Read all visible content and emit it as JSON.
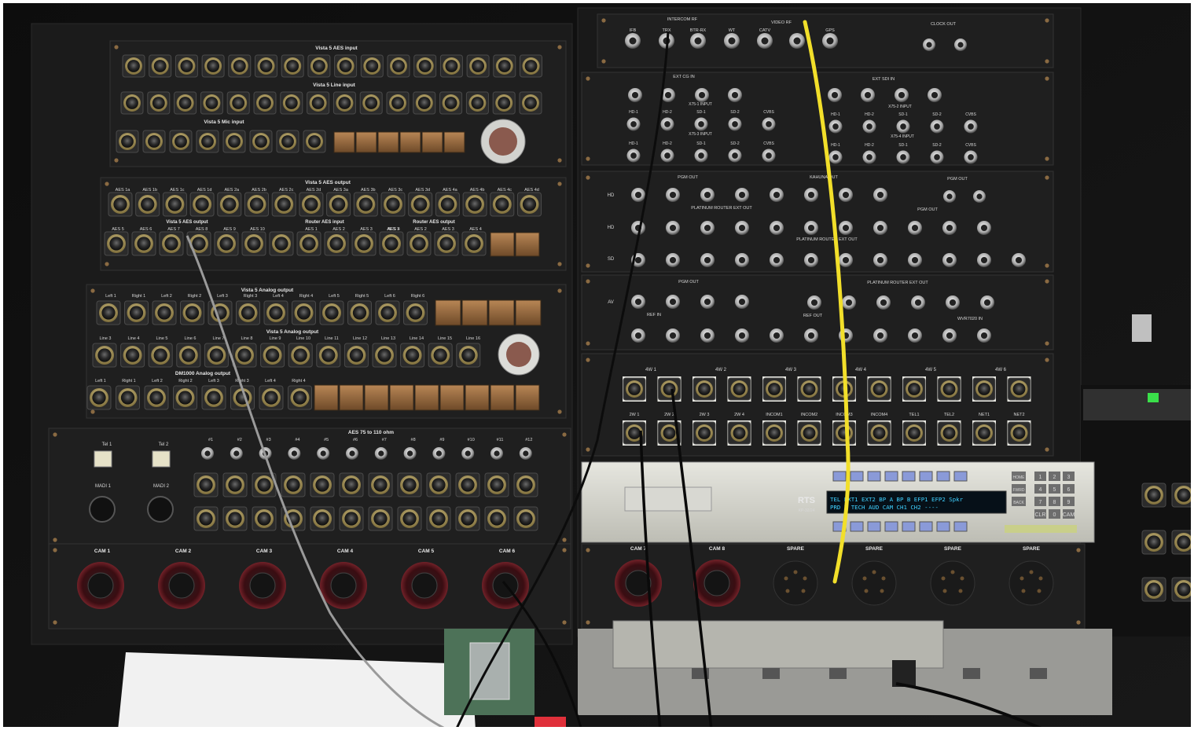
{
  "rack": {
    "left_panel": {
      "aes_input_title": "Vista 5 AES input",
      "line_input_title": "Vista 5 Line input",
      "mic_input_title": "Vista 5 Mic input",
      "aes_output_title": "Vista 5 AES output",
      "aes_output_labels": [
        "AES 1a",
        "AES 1b",
        "AES 1c",
        "AES 1d",
        "AES 2a",
        "AES 2b",
        "AES 2c",
        "AES 2d",
        "AES 3a",
        "AES 3b",
        "AES 3c",
        "AES 3d",
        "AES 4a",
        "AES 4b",
        "AES 4c",
        "AES 4d"
      ],
      "aes_output2_labels": [
        "AES 5",
        "AES 6",
        "AES 7",
        "AES 8",
        "AES 9",
        "AES 10"
      ],
      "aes_output2_title": "Vista 5 AES output",
      "router_aes_input_title": "Router AES input",
      "router_aes_input_labels": [
        "AES 1",
        "AES 2",
        "AES 3",
        "AES 4"
      ],
      "router_aes_output_title": "Router AES output",
      "router_aes_output_labels": [
        "AES 1",
        "AES 2",
        "AES 3",
        "AES 4"
      ],
      "analog_output_title": "Vista 5 Analog output",
      "analog_output_labels": [
        "Left 1",
        "Right 1",
        "Left 2",
        "Right 2",
        "Left 3",
        "Right 3",
        "Left 4",
        "Right 4",
        "Left 5",
        "Right 5",
        "Left 6",
        "Right 6"
      ],
      "analog_output2_title": "Vista 5 Analog output",
      "analog_output2_labels": [
        "Line 3",
        "Line 4",
        "Line 5",
        "Line 6",
        "Line 7",
        "Line 8",
        "Line 9",
        "Line 10",
        "Line 11",
        "Line 12",
        "Line 13",
        "Line 14",
        "Line 15",
        "Line 16"
      ],
      "dm1000_title": "DM1000 Analog output",
      "dm1000_labels": [
        "Left 1",
        "Right 1",
        "Left 2",
        "Right 2",
        "Left 3",
        "Right 3",
        "Left 4",
        "Right 4"
      ],
      "aes75_title": "AES 75 to 110 ohm",
      "aes75_labels": [
        "#1",
        "#2",
        "#3",
        "#4",
        "#5",
        "#6",
        "#7",
        "#8",
        "#9",
        "#10",
        "#11",
        "#12"
      ],
      "tel_labels": [
        "Tel 1",
        "Tel 2"
      ],
      "madi_labels": [
        "MADI 1",
        "MADI 2"
      ],
      "cam_labels": [
        "CAM 1",
        "CAM 2",
        "CAM 3",
        "CAM 4",
        "CAM 5",
        "CAM 6"
      ]
    },
    "right_panel": {
      "top_labels": [
        "IFB",
        "TRX",
        "BTR-RX",
        "WT",
        "CATV",
        "GPS"
      ],
      "intercom_rf_title": "INTERCOM RF",
      "video_rf_title": "VIDEO RF",
      "clock_out_title": "CLOCK OUT",
      "ext_cg_in_title": "EXT CG IN",
      "ext_sdi_in_title": "EXT SDI IN",
      "x75_1_input": "X75-1 INPUT",
      "x75_2_input": "X75-2 INPUT",
      "x75_3_input": "X75-3 INPUT",
      "x75_4_input": "X75-4 INPUT",
      "hd_labels": [
        "HD-1",
        "HD-2",
        "SD-1",
        "SD-2",
        "CVBS"
      ],
      "pgm_out_title": "PGM OUT",
      "kahuna_out_title": "KAHUNA OUT",
      "platinum_router_ext_out": "PLATINUM ROUTER EXT OUT",
      "row_labels": [
        "HD",
        "HD",
        "SD",
        "AV"
      ],
      "ref_in_title": "REF IN",
      "ref_out_title": "REF OUT",
      "wvr_in_title": "WVR7020 IN",
      "fourw_labels": [
        "4W 1",
        "4W 2",
        "4W 3",
        "4W 4",
        "4W 5",
        "4W 6"
      ],
      "twow_labels": [
        "2W 1",
        "2W 2",
        "2W 3",
        "2W 4",
        "INCOM1",
        "INCOM2",
        "INCOM3",
        "INCOM4",
        "TEL1",
        "TEL2",
        "NET1",
        "NET2"
      ],
      "cam_labels": [
        "CAM 7",
        "CAM 8",
        "SPARE",
        "SPARE",
        "SPARE",
        "SPARE"
      ]
    },
    "intercom_unit": {
      "brand": "RTS",
      "model": "KP-32/24",
      "display_line1": "TEL  EXT1 EXT2 BP A BP B EFP1 EFP2 Spkr",
      "display_line2": "PRD  2    TECH AUD CAM  CH1  CH2  ----",
      "keypad": [
        "1",
        "2",
        "3",
        "4",
        "5",
        "6",
        "7",
        "8",
        "9",
        "CLR",
        "0",
        "CAM"
      ],
      "side_keys": [
        "HOME",
        "FWRD",
        "BACK"
      ]
    }
  },
  "colors": {
    "rack_black": "#151515",
    "panel_black": "#1c1c1c",
    "yellow_cable": "#f2df2a",
    "grey_cable": "#9a9a9a",
    "lcd_blue": "#3fd0ff"
  }
}
